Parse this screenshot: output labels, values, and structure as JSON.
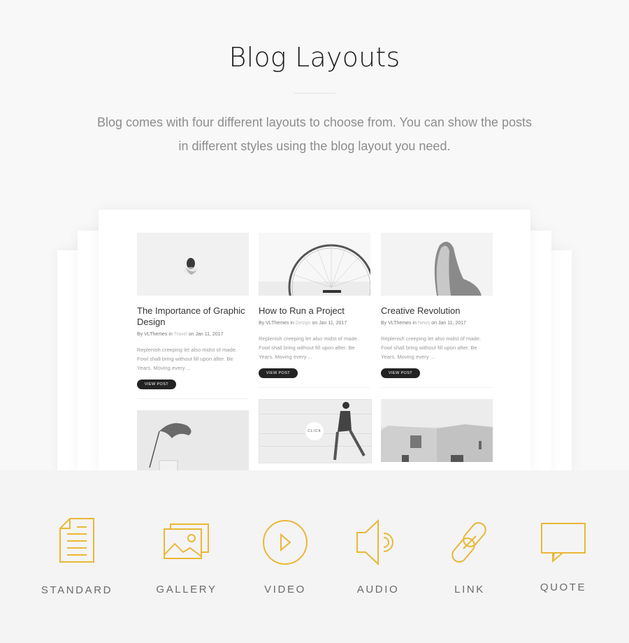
{
  "hero": {
    "title": "Blog Layouts",
    "description": "Blog comes with four different layouts to choose from. You can show the posts in different styles using the blog layout you need."
  },
  "preview": {
    "posts": [
      {
        "title": "The Importance of Graphic Design",
        "meta_by": "By VLThemes in ",
        "category": "Travel",
        "meta_date": " on Jan 11, 2017",
        "excerpt": "Replenish creeping let also midst of made. Fowl shall bring without fill upon after. Be Years. Moving every ...",
        "button": "VIEW POST",
        "image": "swimmer-from-above"
      },
      {
        "title": "How to Run a Project",
        "meta_by": "By VLThemes in ",
        "category": "Design",
        "meta_date": " on Jan 11, 2017",
        "excerpt": "Replenish creeping let also midst of made. Fowl shall bring without fill upon after. Be Years. Moving every ...",
        "button": "VIEW POST",
        "image": "ferris-wheel"
      },
      {
        "title": "Creative Revolution",
        "meta_by": "By VLThemes in ",
        "category": "News",
        "meta_date": " on Jan 11, 2017",
        "excerpt": "Replenish creeping let also midst of made. Fowl shall bring without fill upon after. Be Years. Moving every ...",
        "button": "VIEW POST",
        "image": "woman-back-hair"
      }
    ],
    "second_row": [
      {
        "image": "monstera-leaf-vase"
      },
      {
        "image": "man-sitting-steps",
        "overlay_label": "CLICK"
      },
      {
        "image": "concrete-building"
      }
    ]
  },
  "formats": [
    {
      "label": "STANDARD",
      "icon": "document-icon"
    },
    {
      "label": "GALLERY",
      "icon": "gallery-icon"
    },
    {
      "label": "VIDEO",
      "icon": "play-circle-icon"
    },
    {
      "label": "AUDIO",
      "icon": "speaker-icon"
    },
    {
      "label": "LINK",
      "icon": "chain-link-icon"
    },
    {
      "label": "QUOTE",
      "icon": "speech-bubble-icon"
    }
  ],
  "colors": {
    "accent": "#eab737",
    "button_dark": "#232323"
  }
}
